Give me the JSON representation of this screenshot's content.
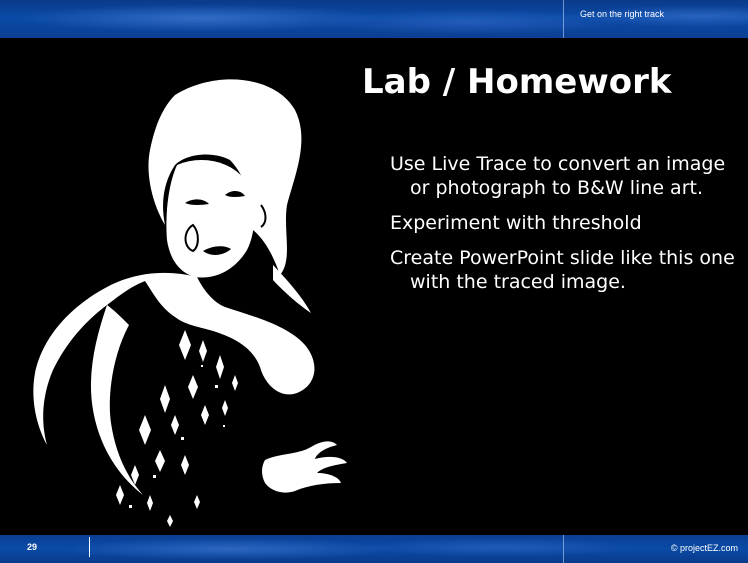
{
  "header": {
    "tagline": "Get on the right track"
  },
  "slide": {
    "title": "Lab / Homework",
    "bullets": [
      "Use Live Trace to convert an image or photograph to B&W line art.",
      "Experiment with threshold",
      "Create PowerPoint slide like this one with the traced image."
    ]
  },
  "footer": {
    "page_number": "29",
    "copyright": "© projectEZ.com"
  },
  "colors": {
    "background": "#000000",
    "banner_blue": "#0a4aa6",
    "text": "#ffffff"
  },
  "icons": {
    "artwork": "woman-silhouette-line-art"
  }
}
